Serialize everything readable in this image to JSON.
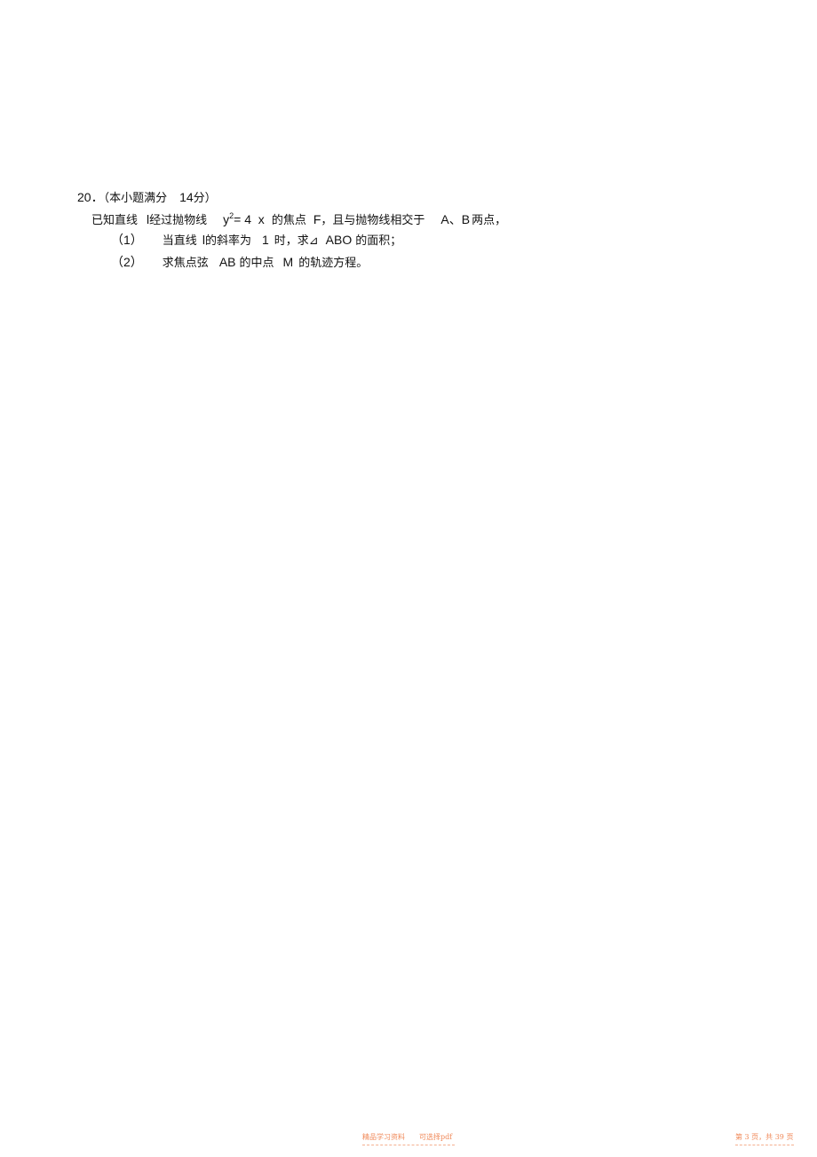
{
  "problem": {
    "number": "20．",
    "score_note_open": "（本小题满分",
    "score": "14",
    "score_note_close": "分）",
    "stem": {
      "part1": "已知直线",
      "line_name": "l",
      "part2": "经过抛物线",
      "eq_var": "y",
      "eq_exp": "2",
      "eq_rest": "= 4  x",
      "part3": "的焦点",
      "focus": "F",
      "part4": "，且与抛物线相交于",
      "points": "A、B",
      "part5": "两点，"
    },
    "sub1": {
      "label": "（1）",
      "part1": "当直线",
      "line_name": "l",
      "part2": "的斜率为",
      "slope": "1",
      "part3": "时，求⊿",
      "triangle": "ABO",
      "part4": "的面积；"
    },
    "sub2": {
      "label": "（2）",
      "part1": "求焦点弦",
      "chord": "AB",
      "part2": "的中点",
      "midpoint": "M",
      "part3": "的轨迹方程。"
    }
  },
  "footer": {
    "left": "精品学习资料　　可选择pdf",
    "right": "第 3 页，共 39 页"
  }
}
